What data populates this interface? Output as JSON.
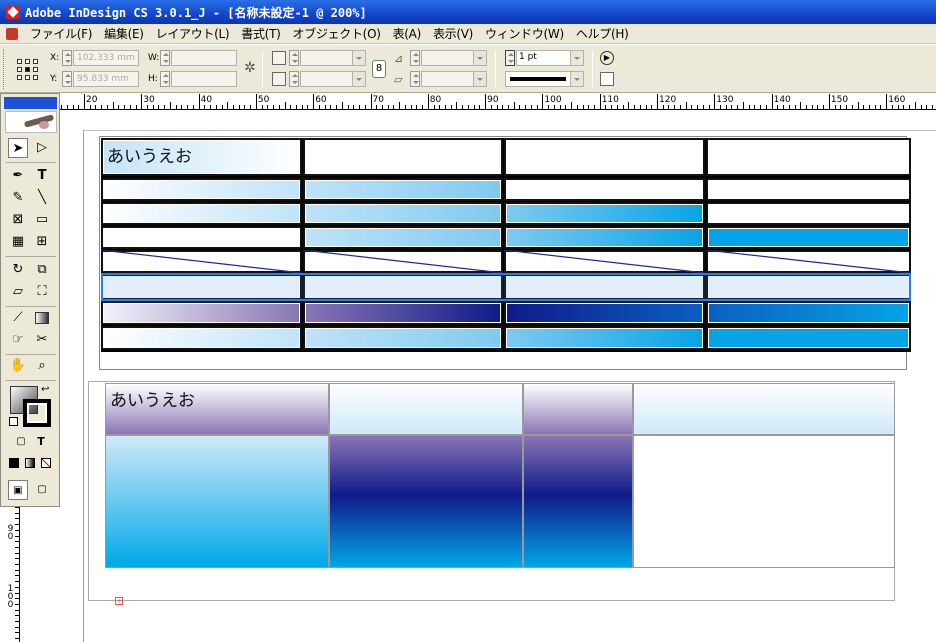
{
  "window": {
    "title": "Adobe InDesign CS 3.0.1_J - [名称未設定-1 @ 200%]"
  },
  "menu": [
    "ファイル(F)",
    "編集(E)",
    "レイアウト(L)",
    "書式(T)",
    "オブジェクト(O)",
    "表(A)",
    "表示(V)",
    "ウィンドウ(W)",
    "ヘルプ(H)"
  ],
  "control": {
    "x_label": "X:",
    "x_value": "102.333 mm",
    "y_label": "Y:",
    "y_value": "95.833 mm",
    "w_label": "W:",
    "h_label": "H:",
    "stroke_weight": "1 pt"
  },
  "ruler": {
    "top_labels": [
      "20",
      "30",
      "40",
      "50",
      "60",
      "70",
      "80",
      "90",
      "100",
      "110",
      "120",
      "130",
      "140",
      "150",
      "160"
    ],
    "left_labels": [
      "90",
      "100"
    ]
  },
  "tools": [
    "selection-tool",
    "direct-selection-tool",
    "pen-tool",
    "type-tool",
    "pencil-tool",
    "line-tool",
    "rectangle-frame-tool",
    "rectangle-tool",
    "table-tool",
    "grid-tool",
    "rotate-tool",
    "scale-tool",
    "shear-tool",
    "free-transform-tool",
    "eyedropper-tool",
    "gradient-tool",
    "button-tool",
    "scissors-tool",
    "hand-tool",
    "zoom-tool"
  ],
  "table1": {
    "first_cell_text": "あいうえお"
  },
  "table2": {
    "first_cell_text": "あいうえお"
  },
  "colors": {
    "accent": "#1b52d9",
    "cyan": "#00a8e8",
    "navy": "#101a8a",
    "violet": "#8a75b5",
    "selection": "#2b7de9"
  }
}
